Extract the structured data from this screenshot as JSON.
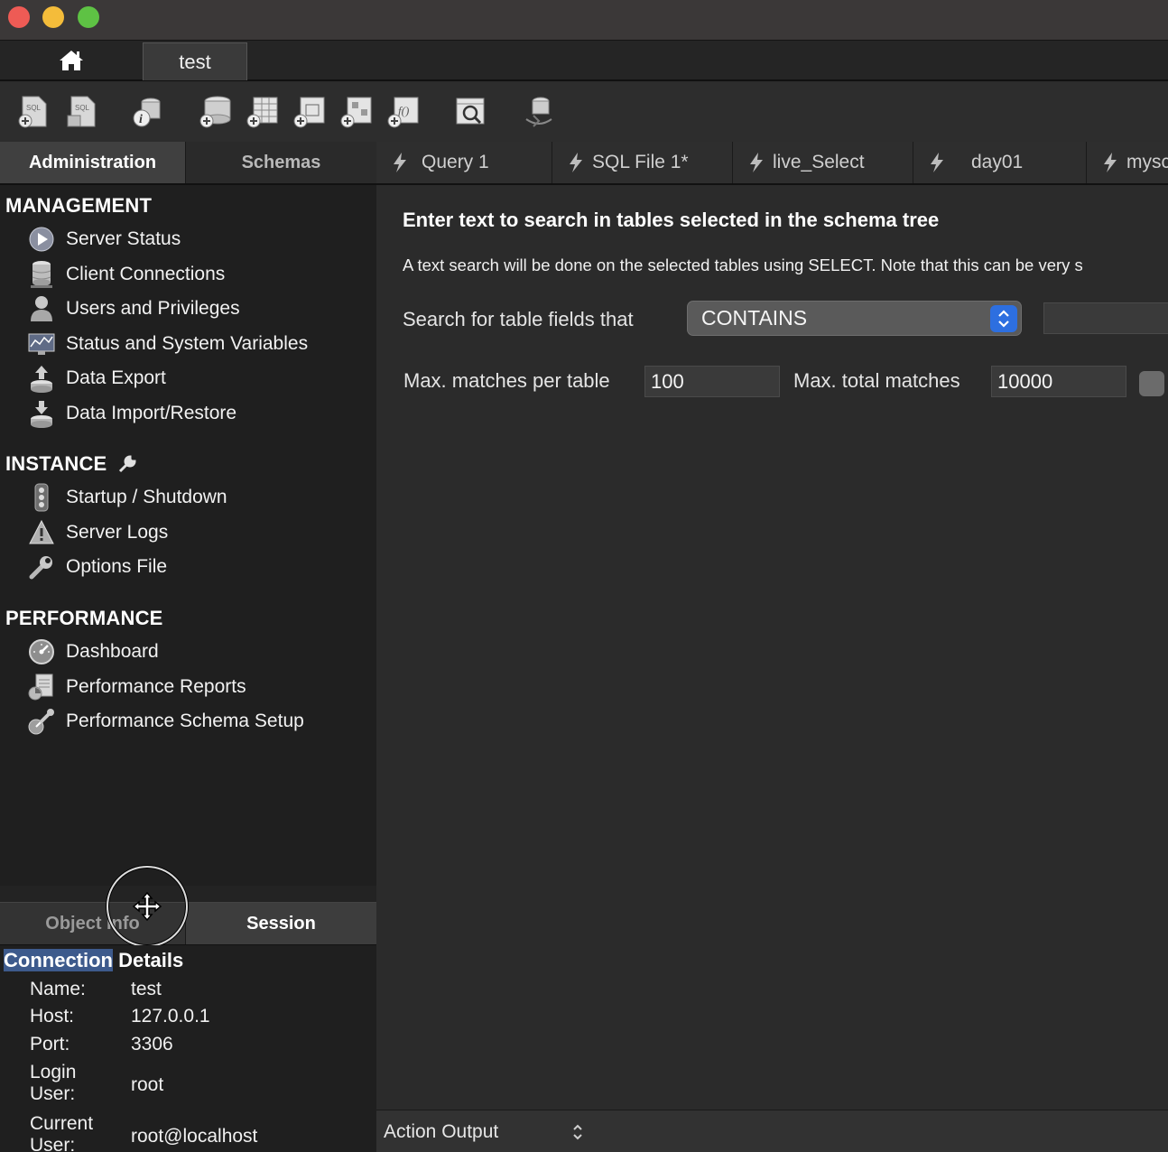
{
  "connection_tab": {
    "label": "test"
  },
  "sidebar_tabs": {
    "administration": "Administration",
    "schemas": "Schemas"
  },
  "editor_tabs": [
    {
      "label": "Query 1"
    },
    {
      "label": "SQL File 1*"
    },
    {
      "label": "live_Select"
    },
    {
      "label": "day01"
    },
    {
      "label": "mysc"
    }
  ],
  "sections": {
    "management": {
      "title": "MANAGEMENT",
      "items": [
        {
          "label": "Server Status",
          "icon": "play-circle-icon"
        },
        {
          "label": "Client Connections",
          "icon": "database-stack-icon"
        },
        {
          "label": "Users and Privileges",
          "icon": "user-icon"
        },
        {
          "label": "Status and System Variables",
          "icon": "monitor-chart-icon"
        },
        {
          "label": "Data Export",
          "icon": "export-icon"
        },
        {
          "label": "Data Import/Restore",
          "icon": "import-icon"
        }
      ]
    },
    "instance": {
      "title": "INSTANCE",
      "items": [
        {
          "label": "Startup / Shutdown",
          "icon": "traffic-light-icon"
        },
        {
          "label": "Server Logs",
          "icon": "warning-icon"
        },
        {
          "label": "Options File",
          "icon": "wrench-icon"
        }
      ]
    },
    "performance": {
      "title": "PERFORMANCE",
      "items": [
        {
          "label": "Dashboard",
          "icon": "gauge-icon"
        },
        {
          "label": "Performance Reports",
          "icon": "reports-icon"
        },
        {
          "label": "Performance Schema Setup",
          "icon": "schema-setup-icon"
        }
      ]
    }
  },
  "info_tabs": {
    "object_info": "Object Info",
    "session": "Session"
  },
  "connection_details": {
    "title_highlight": "Connection",
    "title_rest": " Details",
    "rows": [
      {
        "key": "Name:",
        "value": "test"
      },
      {
        "key": "Host:",
        "value": "127.0.0.1"
      },
      {
        "key": "Port:",
        "value": "3306"
      },
      {
        "key": "Login\nUser:",
        "value": "root"
      },
      {
        "key": "Current\nUser:",
        "value": "root@localhost"
      }
    ]
  },
  "search": {
    "heading": "Enter text to search in tables selected in the schema tree",
    "description": "A text search will be done on the selected tables using SELECT. Note that this can be very s",
    "fields_label": "Search for table fields that",
    "match_mode": "CONTAINS",
    "max_per_table_label": "Max. matches per table",
    "max_per_table_value": "100",
    "max_total_label": "Max. total matches",
    "max_total_value": "10000"
  },
  "action_output": {
    "label": "Action Output"
  },
  "colors": {
    "accent": "#2d6fe0",
    "highlight": "#3d5a8c"
  }
}
